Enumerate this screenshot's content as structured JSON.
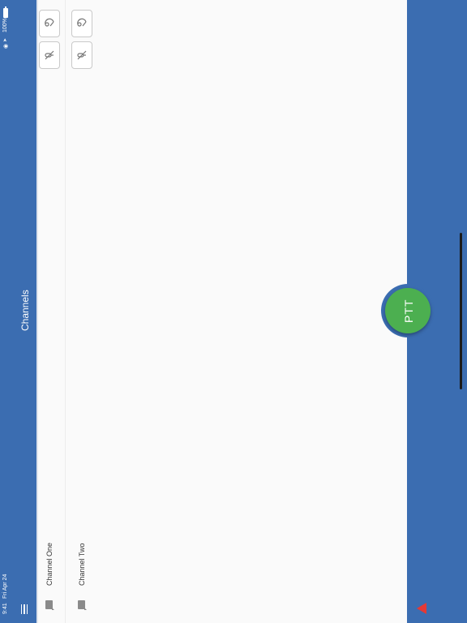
{
  "status": {
    "time": "9:41",
    "date": "Fri Apr 24",
    "battery": "100%"
  },
  "header": {
    "title": "Channels",
    "menu_icon": "menu-icon"
  },
  "channels": [
    {
      "name": "Channel One",
      "icon": "channel-icon",
      "actions": [
        "headset-icon",
        "mic-muted-icon"
      ]
    },
    {
      "name": "Channel Two",
      "icon": "channel-icon",
      "actions": [
        "headset-icon",
        "mic-muted-icon"
      ]
    }
  ],
  "ptt": {
    "label": "PTT"
  },
  "colors": {
    "primary": "#3b6db1",
    "ptt_green": "#4caf50",
    "warning": "#e53935",
    "background": "#fafafa"
  }
}
